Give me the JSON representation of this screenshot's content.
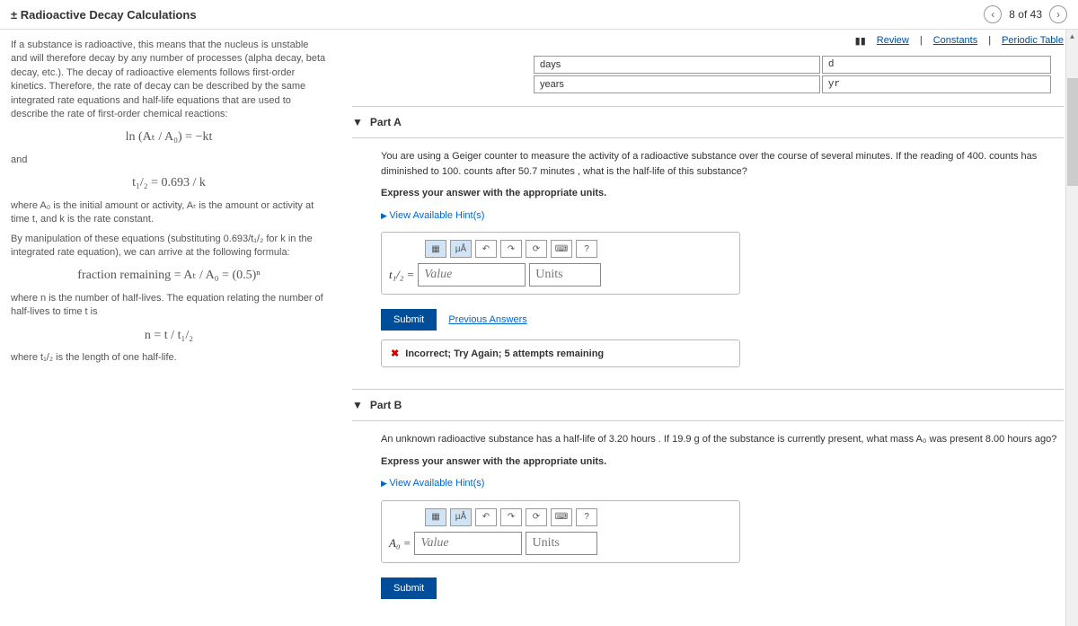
{
  "header": {
    "title": "± Radioactive Decay Calculations",
    "page_indicator": "8 of 43"
  },
  "subheader": {
    "review": "Review",
    "constants": "Constants",
    "periodic": "Periodic Table"
  },
  "unit_rows": [
    {
      "name": "days",
      "abbr": "d"
    },
    {
      "name": "years",
      "abbr": "yr"
    }
  ],
  "left_panel": {
    "intro": "If a substance is radioactive, this means that the nucleus is unstable and will therefore decay by any number of processes (alpha decay, beta decay, etc.). The decay of radioactive elements follows first-order kinetics. Therefore, the rate of decay can be described by the same integrated rate equations and half-life equations that are used to describe the rate of first-order chemical reactions:",
    "eq1": "ln (Aₜ / A₀) = −kt",
    "and": "and",
    "eq2": "t₁/₂ = 0.693 / k",
    "where1": "where A₀ is the initial amount or activity, Aₜ is the amount or activity at time t, and k is the rate constant.",
    "manip": "By manipulation of these equations (substituting 0.693/t₁/₂ for k in the integrated rate equation), we can arrive at the following formula:",
    "eq3": "fraction remaining = Aₜ / A₀ = (0.5)ⁿ",
    "where2": "where n is the number of half-lives. The equation relating the number of half-lives to time t is",
    "eq4": "n = t / t₁/₂",
    "where3": "where t₁/₂ is the length of one half-life."
  },
  "partA": {
    "label": "Part A",
    "question": "You are using a Geiger counter to measure the activity of a radioactive substance over the course of several minutes. If the reading of 400. counts has diminished to 100. counts after 50.7 minutes , what is the half-life of this substance?",
    "instruction": "Express your answer with the appropriate units.",
    "hint": "View Available Hint(s)",
    "var": "t₁/₂ =",
    "value_ph": "Value",
    "units_ph": "Units",
    "submit": "Submit",
    "prev": "Previous Answers",
    "feedback": "Incorrect; Try Again; 5 attempts remaining"
  },
  "partB": {
    "label": "Part B",
    "question": "An unknown radioactive substance has a half-life of 3.20 hours . If 19.9 g of the substance is currently present, what mass A₀ was present 8.00 hours ago?",
    "instruction": "Express your answer with the appropriate units.",
    "hint": "View Available Hint(s)",
    "var": "A₀ =",
    "value_ph": "Value",
    "units_ph": "Units",
    "submit": "Submit"
  }
}
